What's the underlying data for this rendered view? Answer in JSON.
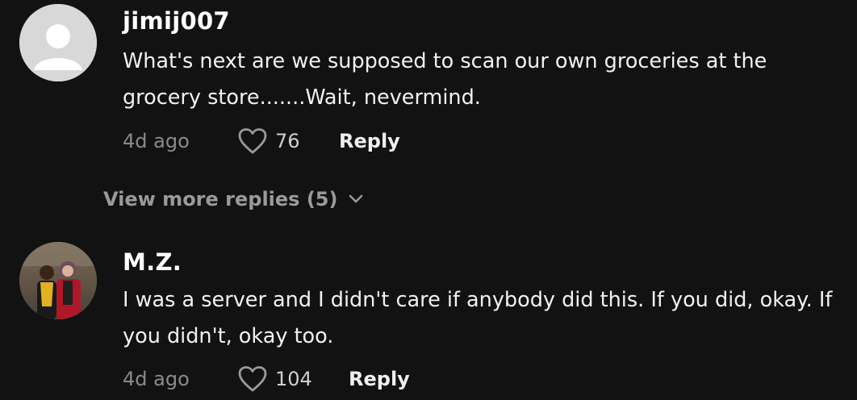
{
  "comments": [
    {
      "username": "jimij007",
      "text": "What's next are we supposed to scan our own groceries at the grocery store.......Wait, nevermind.",
      "time": "4d ago",
      "likes": "76",
      "reply_label": "Reply",
      "avatar_icon": "default-user-icon",
      "view_more_label": "View more replies (5)"
    },
    {
      "username": "M.Z.",
      "text": "I was a server and I didn't care if anybody did this. If you did, okay. If you didn't, okay too.",
      "time": "4d ago",
      "likes": "104",
      "reply_label": "Reply",
      "avatar_icon": "user-photo-avatar"
    }
  ],
  "colors": {
    "background": "#121212",
    "meta_text": "#8a8a8a",
    "view_more_text": "#9a9a9a"
  }
}
